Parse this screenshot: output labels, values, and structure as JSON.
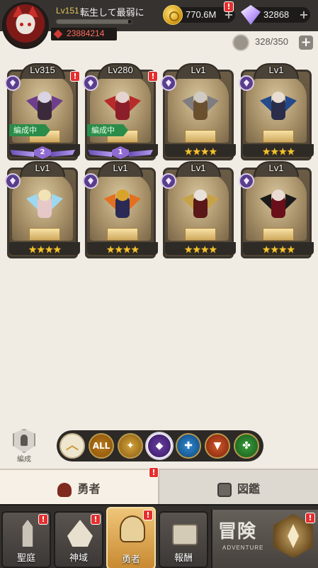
{
  "player": {
    "level": "Lv151",
    "name": "転生して最弱に",
    "exp_fraction": 0.95,
    "combat_power": "23884214",
    "avatar_icon": "cat-knight-avatar"
  },
  "resources": {
    "gold": {
      "value": "770.6M",
      "icon": "gold-coin-icon"
    },
    "gems": {
      "value": "32868",
      "icon": "diamond-icon"
    },
    "plus": "+",
    "alert": "!"
  },
  "capacity": {
    "text": "328/350",
    "add": "+"
  },
  "heroes": [
    {
      "level": "Lv315",
      "stars": "",
      "rank": "2",
      "formation": "編成中",
      "alert": "!",
      "palette": [
        "#3a2a3a",
        "#d9d4e4",
        "#6e3e8c"
      ]
    },
    {
      "level": "Lv280",
      "stars": "",
      "rank": "1",
      "formation": "編成中",
      "alert": "!",
      "palette": [
        "#8c1e2a",
        "#e4d3cf",
        "#b72b2b"
      ]
    },
    {
      "level": "Lv1",
      "stars": "★★★★",
      "rank": "",
      "formation": "",
      "alert": "",
      "palette": [
        "#6b5030",
        "#cfcbc4",
        "#7e7e80"
      ]
    },
    {
      "level": "Lv1",
      "stars": "★★★★",
      "rank": "",
      "formation": "",
      "alert": "",
      "palette": [
        "#2a2e4a",
        "#e9dcd0",
        "#244a8c"
      ]
    },
    {
      "level": "Lv1",
      "stars": "★★★★",
      "rank": "",
      "formation": "",
      "alert": "",
      "palette": [
        "#e7c8c8",
        "#f1e3b5",
        "#9dd8f0"
      ]
    },
    {
      "level": "Lv1",
      "stars": "★★★★",
      "rank": "",
      "formation": "",
      "alert": "",
      "palette": [
        "#2a2a55",
        "#d9a32b",
        "#e3701e"
      ]
    },
    {
      "level": "Lv1",
      "stars": "★★★★",
      "rank": "",
      "formation": "",
      "alert": "",
      "palette": [
        "#5a1818",
        "#e9e2da",
        "#c8a247"
      ]
    },
    {
      "level": "Lv1",
      "stars": "★★★★",
      "rank": "",
      "formation": "",
      "alert": "",
      "palette": [
        "#6a0f1a",
        "#eadcd4",
        "#1a1a1a"
      ]
    }
  ],
  "formation_button": {
    "label": "編成",
    "icon": "pawn-shield-icon"
  },
  "filters": [
    {
      "id": "collapse",
      "glyph": "︿",
      "icon": "chevron-up-icon"
    },
    {
      "id": "all",
      "glyph": "ALL",
      "icon": "all-icon"
    },
    {
      "id": "light",
      "glyph": "✦",
      "icon": "light-wings-icon"
    },
    {
      "id": "dark",
      "glyph": "◆",
      "icon": "dark-eye-icon"
    },
    {
      "id": "sky",
      "glyph": "✚",
      "icon": "sky-sword-icon"
    },
    {
      "id": "beast",
      "glyph": "▼",
      "icon": "beast-mask-icon"
    },
    {
      "id": "nature",
      "glyph": "✤",
      "icon": "tree-icon"
    }
  ],
  "tabs": {
    "heroes": {
      "label": "勇者",
      "icon": "helmet-icon",
      "alert": "!"
    },
    "codex": {
      "label": "図鑑",
      "icon": "star-book-icon"
    }
  },
  "bottom_nav": [
    {
      "id": "courtyard",
      "label": "聖庭",
      "alert": "!",
      "icon": "tower-icon"
    },
    {
      "id": "divine",
      "label": "神域",
      "alert": "!",
      "icon": "divine-crest-icon"
    },
    {
      "id": "heroes",
      "label": "勇者",
      "alert": "!",
      "icon": "helmet-icon"
    },
    {
      "id": "rewards",
      "label": "報酬",
      "alert": "",
      "icon": "treasure-chest-icon"
    }
  ],
  "adventure": {
    "title": "冒険",
    "subtitle": "ADVENTURE",
    "alert": "!",
    "icon": "compass-icon"
  },
  "colors": {
    "background": "#f1ece3",
    "topbar": "#35322f",
    "alert": "#e52e2e",
    "star": "#f3c432",
    "formation_tag": "#2b8c4a"
  }
}
